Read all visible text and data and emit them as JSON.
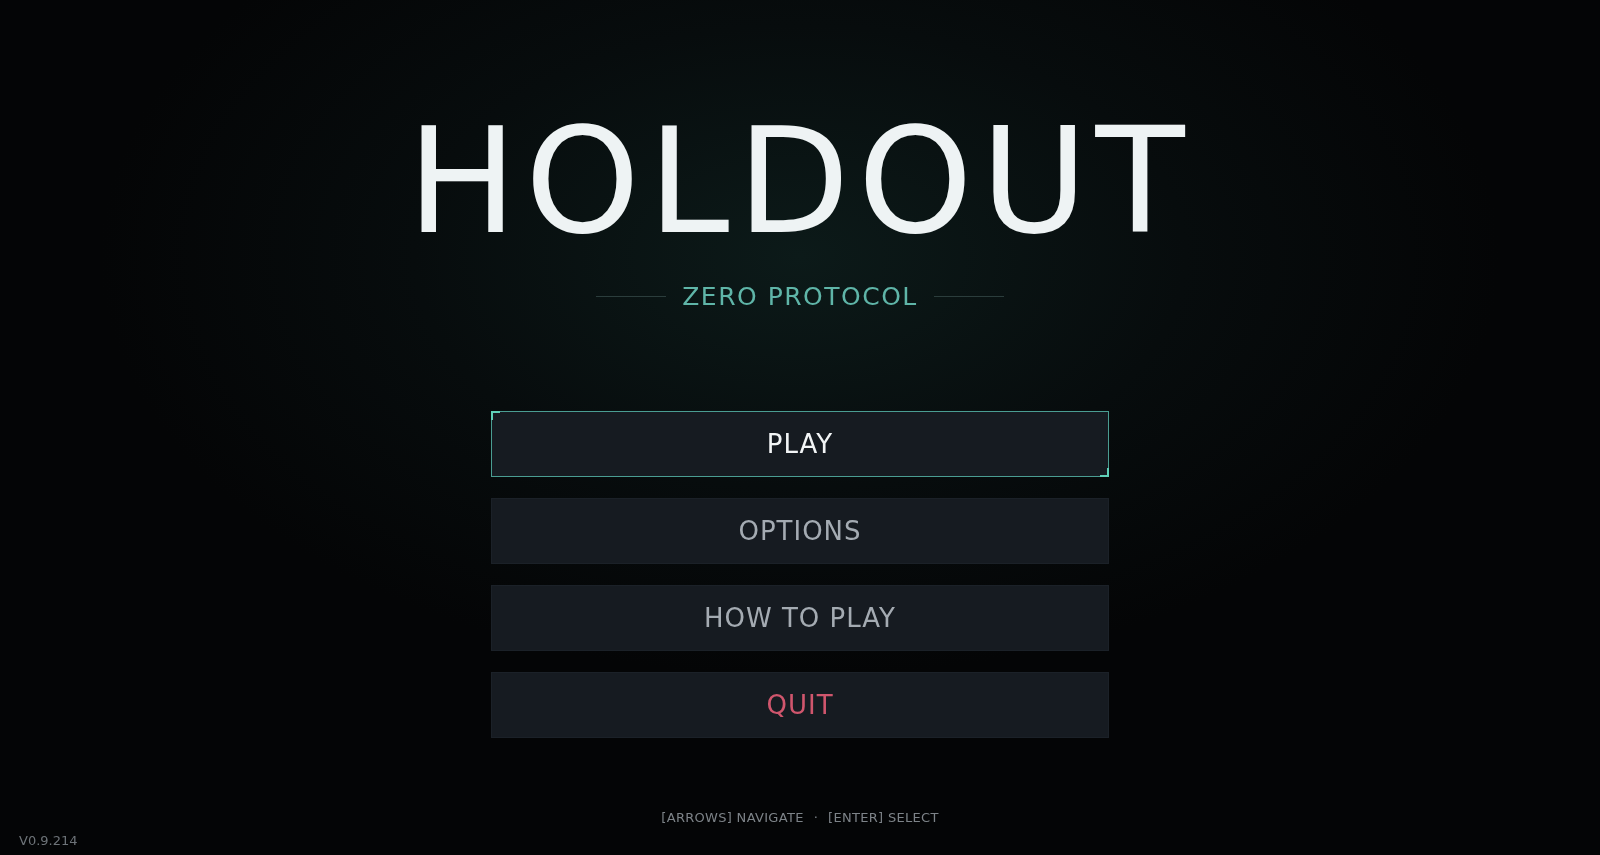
{
  "title": "HOLDOUT",
  "subtitle": "ZERO PROTOCOL",
  "menu": [
    {
      "label": "PLAY",
      "kind": "normal",
      "selected": true
    },
    {
      "label": "OPTIONS",
      "kind": "normal",
      "selected": false
    },
    {
      "label": "HOW TO PLAY",
      "kind": "normal",
      "selected": false
    },
    {
      "label": "QUIT",
      "kind": "danger",
      "selected": false
    }
  ],
  "hints": [
    "[ARROWS] NAVIGATE",
    "[ENTER] SELECT"
  ],
  "hint_separator": "·",
  "version": "V0.9.214"
}
